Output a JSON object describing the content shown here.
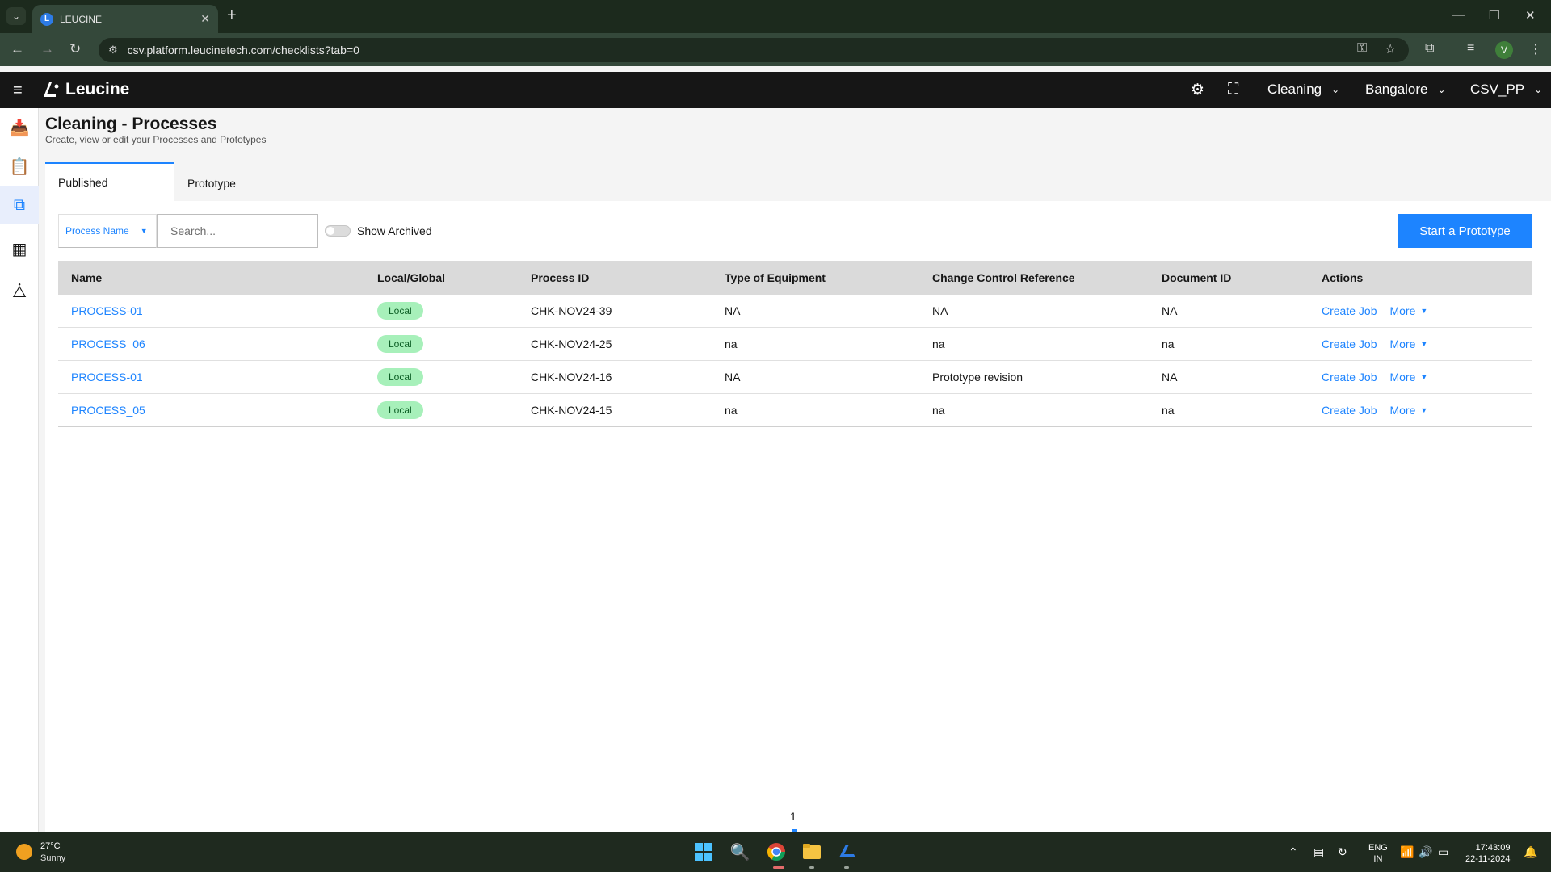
{
  "browser": {
    "tab_title": "LEUCINE",
    "url": "csv.platform.leucinetech.com/checklists?tab=0",
    "profile_initial": "V"
  },
  "app": {
    "brand": "Leucine",
    "facility_dropdowns": [
      "Cleaning",
      "Bangalore",
      "CSV_PP"
    ]
  },
  "page": {
    "title": "Cleaning - Processes",
    "subtitle": "Create, view or edit your Processes and Prototypes",
    "tabs": [
      "Published",
      "Prototype"
    ]
  },
  "filters": {
    "select_label": "Process Name",
    "search_placeholder": "Search...",
    "toggle_label": "Show Archived",
    "primary_button": "Start a Prototype"
  },
  "table": {
    "columns": [
      "Name",
      "Local/Global",
      "Process ID",
      "Type of Equipment",
      "Change Control Reference",
      "Document ID",
      "Actions"
    ],
    "rows": [
      {
        "name": "PROCESS-01",
        "scope": "Local",
        "process_id": "CHK-NOV24-39",
        "equipment": "NA",
        "change_ref": "NA",
        "document_id": "NA",
        "action1": "Create Job",
        "action2": "More"
      },
      {
        "name": "PROCESS_06",
        "scope": "Local",
        "process_id": "CHK-NOV24-25",
        "equipment": "na",
        "change_ref": "na",
        "document_id": "na",
        "action1": "Create Job",
        "action2": "More"
      },
      {
        "name": "PROCESS-01",
        "scope": "Local",
        "process_id": "CHK-NOV24-16",
        "equipment": "NA",
        "change_ref": "Prototype revision",
        "document_id": "NA",
        "action1": "Create Job",
        "action2": "More"
      },
      {
        "name": "PROCESS_05",
        "scope": "Local",
        "process_id": "CHK-NOV24-15",
        "equipment": "na",
        "change_ref": "na",
        "document_id": "na",
        "action1": "Create Job",
        "action2": "More"
      }
    ]
  },
  "pagination": {
    "current_page": "1"
  },
  "taskbar": {
    "temperature": "27°C",
    "condition": "Sunny",
    "lang_top": "ENG",
    "lang_bottom": "IN",
    "time": "17:43:09",
    "date": "22-11-2024"
  },
  "colors": {
    "accent": "#1d84ff",
    "header_bg": "#161616",
    "badge_bg": "#a7f0ba",
    "badge_text": "#0e6027"
  }
}
